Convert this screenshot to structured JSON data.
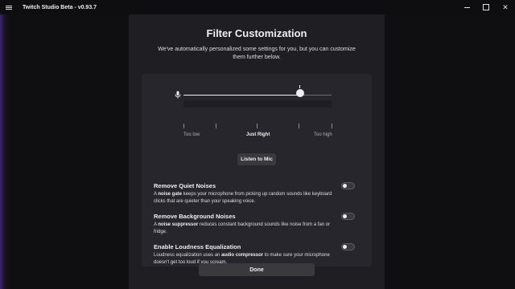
{
  "app": {
    "title": "Twitch Studio Beta - v0.93.7"
  },
  "window_controls": {
    "minimize": "minimize",
    "maximize": "maximize",
    "close": "✕"
  },
  "dialog": {
    "title": "Filter Customization",
    "subtitle": "We've automatically personalized some settings for you, but you can customize them further below."
  },
  "slider": {
    "value_fraction": 0.79,
    "labels": {
      "low": "Too low",
      "mid": "Just Right",
      "high": "Too high"
    }
  },
  "listen_button": "Listen to Mic",
  "options": [
    {
      "title": "Remove Quiet Noises",
      "desc_prefix": "A ",
      "desc_bold": "noise gate",
      "desc_suffix": " keeps your microphone from picking up random sounds like keyboard clicks that are quieter than your speaking voice.",
      "enabled": false
    },
    {
      "title": "Remove Background Noises",
      "desc_prefix": "A ",
      "desc_bold": "noise suppressor",
      "desc_suffix": " reduces constant background sounds like noise from a fan or fridge.",
      "enabled": false
    },
    {
      "title": "Enable Loudness Equalization",
      "desc_prefix": "Loudness equalization uses an ",
      "desc_bold": "audio compressor",
      "desc_suffix": " to make sure your microphone doesn't get too loud if you scream.",
      "enabled": false
    }
  ],
  "done_button": "Done",
  "colors": {
    "accent": "#9147ff",
    "background": "#18181b",
    "panel": "#26262c"
  },
  "icons": {
    "menu": "hamburger-menu-icon",
    "mic": "microphone-icon"
  }
}
